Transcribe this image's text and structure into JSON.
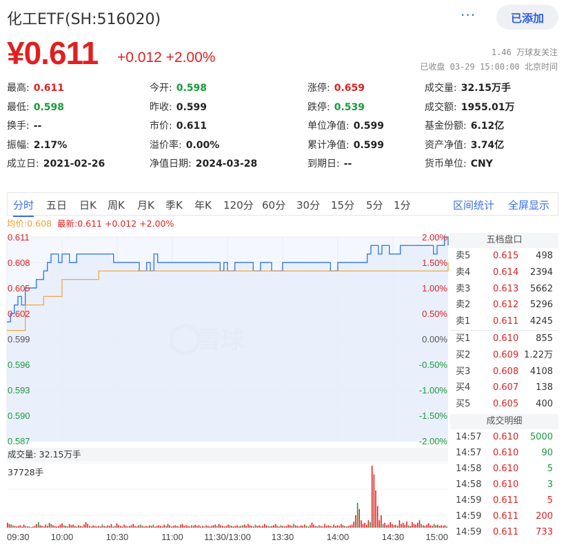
{
  "header": {
    "title": "化工ETF(SH:516020)",
    "more_label": "···",
    "add_label": "已添加",
    "price": "¥0.611",
    "change": "+0.012 +2.00%",
    "followers": "1.46 万球友关注",
    "status_time": "已收盘 03-29 15:00:00 北京时间"
  },
  "stats": [
    [
      {
        "label": "最高:",
        "value": "0.611",
        "tone": "up"
      },
      {
        "label": "今开:",
        "value": "0.598",
        "tone": "dn"
      },
      {
        "label": "涨停:",
        "value": "0.659",
        "tone": "up"
      },
      {
        "label": "成交量:",
        "value": "32.15万手",
        "tone": ""
      }
    ],
    [
      {
        "label": "最低:",
        "value": "0.598",
        "tone": "dn"
      },
      {
        "label": "昨收:",
        "value": "0.599",
        "tone": ""
      },
      {
        "label": "跌停:",
        "value": "0.539",
        "tone": "dn"
      },
      {
        "label": "成交额:",
        "value": "1955.01万",
        "tone": ""
      }
    ],
    [
      {
        "label": "换手:",
        "value": "--",
        "tone": ""
      },
      {
        "label": "市价:",
        "value": "0.611",
        "tone": ""
      },
      {
        "label": "单位净值:",
        "value": "0.599",
        "tone": ""
      },
      {
        "label": "基金份额:",
        "value": "6.12亿",
        "tone": ""
      }
    ],
    [
      {
        "label": "振幅:",
        "value": "2.17%",
        "tone": ""
      },
      {
        "label": "溢价率:",
        "value": "0.00%",
        "tone": ""
      },
      {
        "label": "累计净值:",
        "value": "0.599",
        "tone": ""
      },
      {
        "label": "资产净值:",
        "value": "3.74亿",
        "tone": ""
      }
    ],
    [
      {
        "label": "成立日:",
        "value": "2021-02-26",
        "tone": ""
      },
      {
        "label": "净值日期:",
        "value": "2024-03-28",
        "tone": ""
      },
      {
        "label": "到期日:",
        "value": "--",
        "tone": ""
      },
      {
        "label": "货币单位:",
        "value": "CNY",
        "tone": ""
      }
    ]
  ],
  "tabs": [
    "分时",
    "五日",
    "日K",
    "周K",
    "月K",
    "季K",
    "年K",
    "120分",
    "60分",
    "30分",
    "15分",
    "5分",
    "1分"
  ],
  "tabs_right": [
    "区间统计",
    "全屏显示"
  ],
  "legend": {
    "avg": "均价:0.608",
    "latest": "最新:0.611 +0.012 +2.00%"
  },
  "watermark": "雪球",
  "volume_label": "成交量: 32.15万手",
  "volume_max_label": "37728手",
  "orderbook": {
    "title": "五档盘口",
    "asks": [
      {
        "label": "卖5",
        "price": "0.615",
        "vol": "498",
        "tone": "up"
      },
      {
        "label": "卖4",
        "price": "0.614",
        "vol": "2394",
        "tone": "up"
      },
      {
        "label": "卖3",
        "price": "0.613",
        "vol": "5662",
        "tone": "up"
      },
      {
        "label": "卖2",
        "price": "0.612",
        "vol": "5296",
        "tone": "up"
      },
      {
        "label": "卖1",
        "price": "0.611",
        "vol": "4245",
        "tone": "up"
      }
    ],
    "bids": [
      {
        "label": "买1",
        "price": "0.610",
        "vol": "855",
        "tone": "up"
      },
      {
        "label": "买2",
        "price": "0.609",
        "vol": "1.22万",
        "tone": "up"
      },
      {
        "label": "买3",
        "price": "0.608",
        "vol": "4108",
        "tone": "up"
      },
      {
        "label": "买4",
        "price": "0.607",
        "vol": "138",
        "tone": "up"
      },
      {
        "label": "买5",
        "price": "0.605",
        "vol": "400",
        "tone": "up"
      }
    ]
  },
  "trades": {
    "title": "成交明细",
    "rows": [
      {
        "time": "14:57",
        "price": "0.610",
        "vol": "5000",
        "vtone": "dn"
      },
      {
        "time": "14:57",
        "price": "0.610",
        "vol": "90",
        "vtone": "dn"
      },
      {
        "time": "14:58",
        "price": "0.610",
        "vol": "5",
        "vtone": "dn"
      },
      {
        "time": "14:58",
        "price": "0.610",
        "vol": "3",
        "vtone": "dn"
      },
      {
        "time": "14:59",
        "price": "0.611",
        "vol": "5",
        "vtone": "up"
      },
      {
        "time": "14:59",
        "price": "0.611",
        "vol": "200",
        "vtone": "up"
      },
      {
        "time": "14:59",
        "price": "0.611",
        "vol": "733",
        "vtone": "up"
      }
    ]
  },
  "chart_data": {
    "type": "line",
    "y_ticks": [
      "0.611",
      "0.608",
      "0.605",
      "0.602",
      "0.599",
      "0.596",
      "0.593",
      "0.590",
      "0.587"
    ],
    "pct_ticks": [
      "2.00%",
      "1.50%",
      "1.00%",
      "0.50%",
      "0.00%",
      "-0.50%",
      "-1.00%",
      "-1.50%",
      "-2.00%"
    ],
    "ylim": [
      0.587,
      0.611
    ],
    "prev_close": 0.599,
    "x_ticks": [
      "09:30",
      "10:00",
      "10:30",
      "11:00",
      "11:30/13:00",
      "13:30",
      "14:00",
      "14:30",
      "15:00"
    ],
    "series": [
      {
        "name": "最新",
        "color": "#3a7be8",
        "x": [
          0,
          2,
          4,
          6,
          8,
          10,
          12,
          14,
          16,
          18,
          20,
          22,
          24,
          26,
          28,
          30,
          32,
          34,
          36,
          38,
          40,
          42,
          44,
          46,
          48,
          50,
          52,
          54,
          56,
          58,
          60,
          62,
          64,
          66,
          68,
          70,
          72,
          74,
          76,
          78,
          80,
          82,
          84,
          86,
          88,
          90,
          92,
          94,
          96,
          98,
          100,
          102,
          104,
          106,
          108,
          110,
          112,
          114,
          116,
          118,
          120,
          122,
          124,
          126,
          128,
          130,
          132,
          134,
          136,
          138,
          140,
          142,
          144,
          146,
          148,
          150,
          152,
          154,
          156,
          158,
          160,
          162,
          164,
          166,
          168,
          170,
          172,
          174,
          176,
          178,
          180,
          182,
          184,
          186,
          188,
          190,
          192,
          194,
          196,
          198,
          200,
          202,
          204,
          206,
          208,
          210,
          212,
          214,
          216,
          218,
          220,
          222,
          224,
          226,
          228,
          230,
          232,
          234,
          236,
          238,
          240
        ],
        "y": [
          0.601,
          0.602,
          0.603,
          0.604,
          0.603,
          0.605,
          0.605,
          0.605,
          0.606,
          0.606,
          0.607,
          0.608,
          0.609,
          0.609,
          0.608,
          0.609,
          0.609,
          0.608,
          0.608,
          0.609,
          0.609,
          0.609,
          0.609,
          0.609,
          0.609,
          0.609,
          0.609,
          0.609,
          0.609,
          0.608,
          0.608,
          0.608,
          0.608,
          0.608,
          0.608,
          0.608,
          0.607,
          0.607,
          0.608,
          0.607,
          0.609,
          0.608,
          0.608,
          0.608,
          0.608,
          0.608,
          0.608,
          0.608,
          0.608,
          0.608,
          0.608,
          0.608,
          0.608,
          0.608,
          0.608,
          0.608,
          0.608,
          0.608,
          0.607,
          0.608,
          0.607,
          0.607,
          0.608,
          0.608,
          0.608,
          0.608,
          0.608,
          0.607,
          0.607,
          0.608,
          0.608,
          0.608,
          0.607,
          0.607,
          0.607,
          0.608,
          0.608,
          0.608,
          0.608,
          0.608,
          0.608,
          0.608,
          0.608,
          0.608,
          0.608,
          0.608,
          0.608,
          0.608,
          0.607,
          0.607,
          0.608,
          0.608,
          0.608,
          0.608,
          0.608,
          0.608,
          0.608,
          0.608,
          0.609,
          0.61,
          0.61,
          0.609,
          0.61,
          0.61,
          0.609,
          0.609,
          0.609,
          0.61,
          0.61,
          0.61,
          0.61,
          0.61,
          0.61,
          0.61,
          0.61,
          0.61,
          0.609,
          0.61,
          0.61,
          0.611,
          0.61
        ]
      },
      {
        "name": "均价",
        "color": "#f0a030",
        "x": [
          0,
          10,
          20,
          30,
          40,
          50,
          60,
          70,
          80,
          90,
          100,
          110,
          120,
          130,
          140,
          150,
          160,
          170,
          180,
          190,
          200,
          210,
          220,
          230,
          240
        ],
        "y": [
          0.6,
          0.603,
          0.604,
          0.606,
          0.606,
          0.607,
          0.607,
          0.607,
          0.607,
          0.607,
          0.607,
          0.607,
          0.607,
          0.607,
          0.607,
          0.607,
          0.607,
          0.607,
          0.607,
          0.607,
          0.607,
          0.607,
          0.607,
          0.607,
          0.608
        ]
      }
    ],
    "volume_max": 37728,
    "volume_bars": [
      8,
      6,
      5,
      4,
      3,
      2,
      3,
      4,
      2,
      5,
      3,
      2,
      2,
      1,
      2,
      3,
      6,
      9,
      4,
      3,
      2,
      5,
      3,
      8,
      6,
      4,
      3,
      2,
      3,
      5,
      7,
      4,
      3,
      2,
      6,
      4,
      5,
      3,
      2,
      4,
      3,
      2,
      5,
      9,
      6,
      3,
      2,
      4,
      3,
      2,
      3,
      2,
      5,
      3,
      2,
      4,
      3,
      6,
      2,
      3,
      7,
      4,
      3,
      2,
      5,
      3,
      2,
      3,
      4,
      6,
      3,
      2,
      4,
      5,
      3,
      2,
      3,
      2,
      4,
      3,
      5,
      2,
      3,
      4,
      3,
      2,
      5,
      3,
      6,
      4,
      2,
      3,
      4,
      3,
      2,
      5,
      6,
      3,
      4,
      3,
      2,
      4,
      3,
      5,
      3,
      4,
      2,
      3,
      2,
      4,
      3,
      2,
      3,
      4,
      5,
      3,
      6,
      4,
      3,
      2,
      3,
      5,
      4,
      3,
      2,
      3,
      4,
      2,
      3,
      4,
      5,
      3,
      6,
      4,
      3,
      2,
      5,
      3,
      4,
      2,
      3,
      6,
      4,
      3,
      2,
      3,
      4,
      6,
      3,
      2,
      4,
      3,
      2,
      3,
      5,
      4,
      3,
      6,
      4,
      3,
      2,
      4,
      3,
      5,
      3,
      2,
      4,
      8,
      5,
      3,
      2,
      4,
      3,
      2,
      6,
      3,
      4,
      3,
      2,
      5,
      3,
      4,
      3,
      6,
      4,
      3,
      2,
      3,
      4,
      5,
      10,
      20,
      40,
      30,
      12,
      6,
      8,
      5,
      12,
      9,
      100,
      86,
      60,
      35,
      12,
      20,
      6,
      8,
      4,
      5,
      9,
      6,
      4,
      5,
      3,
      12,
      6,
      8,
      5,
      10,
      4,
      3,
      9,
      6,
      5,
      8,
      12,
      6,
      4,
      3,
      5,
      7,
      4,
      3,
      6,
      4,
      5,
      3,
      4,
      3,
      4,
      2
    ]
  }
}
